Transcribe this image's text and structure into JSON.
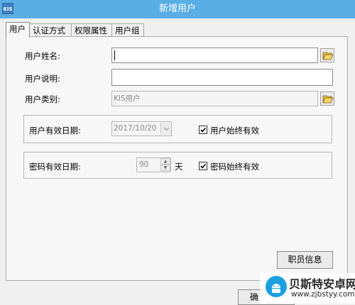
{
  "window": {
    "app_icon_text": "KIS",
    "title": "新增用户"
  },
  "tabs": [
    "用户",
    "认证方式",
    "权限属性",
    "用户组"
  ],
  "form": {
    "user_name_label": "用户姓名:",
    "user_name_value": "",
    "user_desc_label": "用户说明:",
    "user_desc_value": "",
    "user_type_label": "用户类别:",
    "user_type_value": "KIS用户"
  },
  "validity": {
    "user_date_label": "用户有效日期:",
    "user_date_value": "2017/10/20",
    "user_always_checked": true,
    "user_always_label": "用户始终有效",
    "pwd_date_label": "密码有效日期:",
    "pwd_days_value": "90",
    "pwd_days_unit": "天",
    "pwd_always_checked": true,
    "pwd_always_label": "密码始终有效"
  },
  "buttons": {
    "employee_info": "职员信息",
    "partial_bottom": "确"
  },
  "watermark": {
    "title": "贝斯特安卓网",
    "url": "www.zjbstyy.com"
  },
  "colors": {
    "titlebar": "#5aaee6",
    "watermark_logo": "#1aa0e0"
  }
}
